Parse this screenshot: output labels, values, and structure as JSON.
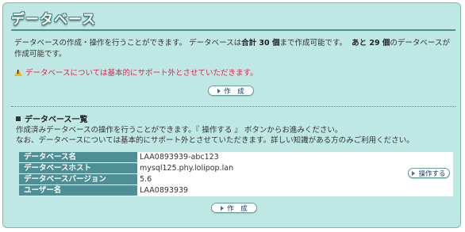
{
  "page": {
    "title": "データベース"
  },
  "intro": {
    "part1": "データベースの作成・操作を行うことができます。 データベースは",
    "total_label": "合計 30 個",
    "part2": "まで作成可能です。",
    "remaining_label": "あと 29 個",
    "part3": "のデータベースが作成可能です。"
  },
  "warning": {
    "text": "データベースについては基本的にサポート外とさせていただきます。",
    "icon": "warning-icon"
  },
  "create_button_top": {
    "label": "作　成"
  },
  "list_section": {
    "title": "データベース一覧",
    "desc_line1": "作成済みデータベースの操作を行うことができます。『 操作する 』 ボタンからお進みください。",
    "desc_line2": "なお、データベースについては基本的にサポート外とさせていただきます。詳しい知識がある方のみご利用ください。"
  },
  "database": {
    "rows": [
      {
        "label": "データベース名",
        "value": "LAA0893939-abc123"
      },
      {
        "label": "データベースホスト",
        "value": "mysql125.phy.lolipop.lan"
      },
      {
        "label": "データベースバージョン",
        "value": "5.6"
      },
      {
        "label": "ユーザー名",
        "value": "LAA0893939"
      }
    ],
    "operate_button": "操作する"
  },
  "create_button_bottom": {
    "label": "作　成"
  },
  "colors": {
    "panel_bg": "#bfe7e3",
    "header_cell": "#4d8f94",
    "warning_text": "#e0224f"
  }
}
